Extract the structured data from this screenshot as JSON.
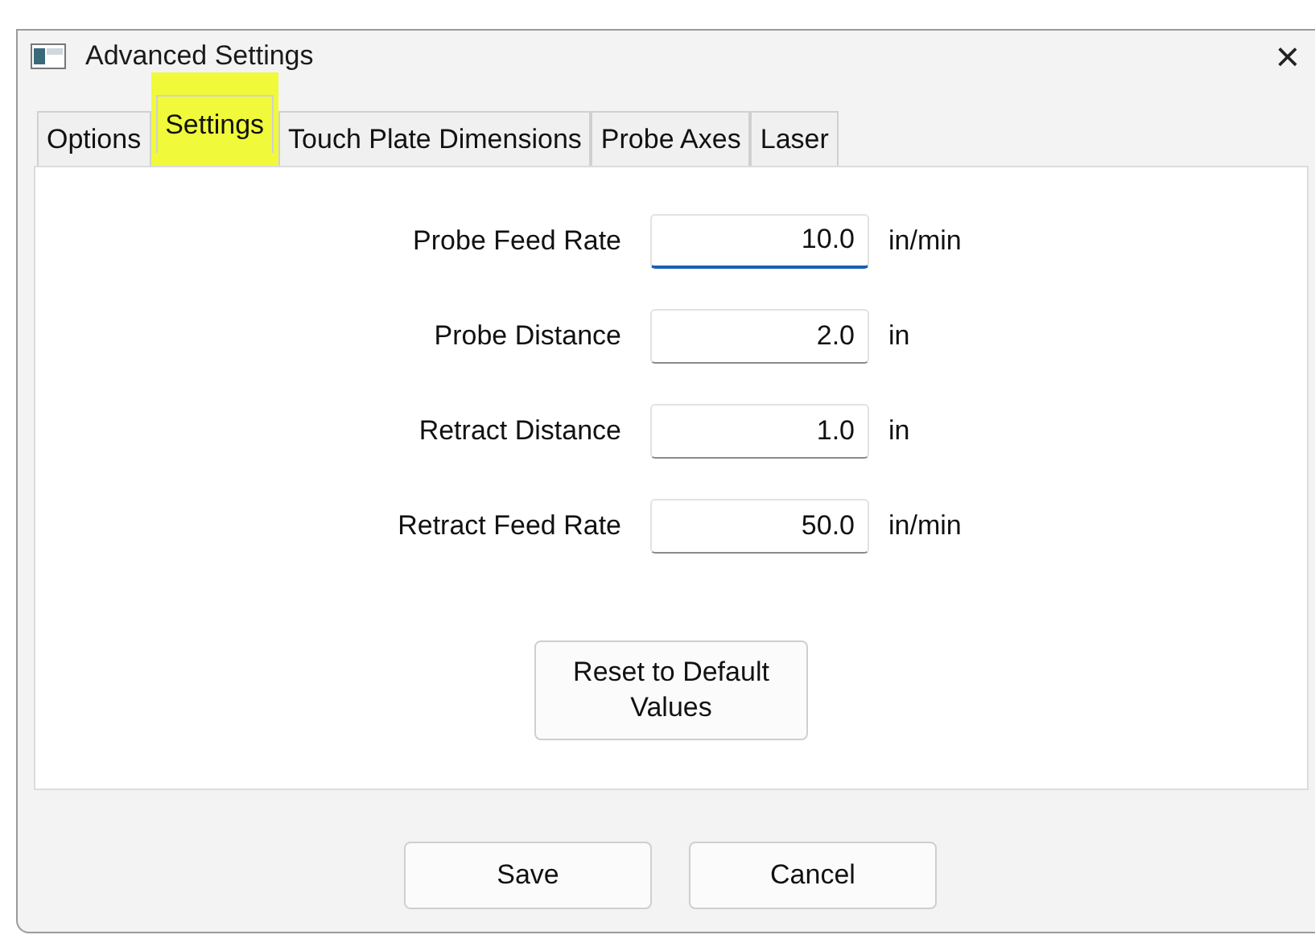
{
  "window": {
    "title": "Advanced Settings",
    "close": "×"
  },
  "tabs": [
    {
      "label": "Options",
      "selected": false,
      "highlighted": false
    },
    {
      "label": "Settings",
      "selected": true,
      "highlighted": true
    },
    {
      "label": "Touch Plate Dimensions",
      "selected": false,
      "highlighted": false
    },
    {
      "label": "Probe Axes",
      "selected": false,
      "highlighted": false
    },
    {
      "label": "Laser",
      "selected": false,
      "highlighted": false
    }
  ],
  "fields": [
    {
      "label": "Probe Feed Rate",
      "value": "10.0",
      "unit": "in/min",
      "focused": true
    },
    {
      "label": "Probe Distance",
      "value": "2.0",
      "unit": "in",
      "focused": false
    },
    {
      "label": "Retract Distance",
      "value": "1.0",
      "unit": "in",
      "focused": false
    },
    {
      "label": "Retract Feed Rate",
      "value": "50.0",
      "unit": "in/min",
      "focused": false
    }
  ],
  "reset_button": "Reset to Default Values",
  "buttons": [
    "Save",
    "Cancel"
  ]
}
